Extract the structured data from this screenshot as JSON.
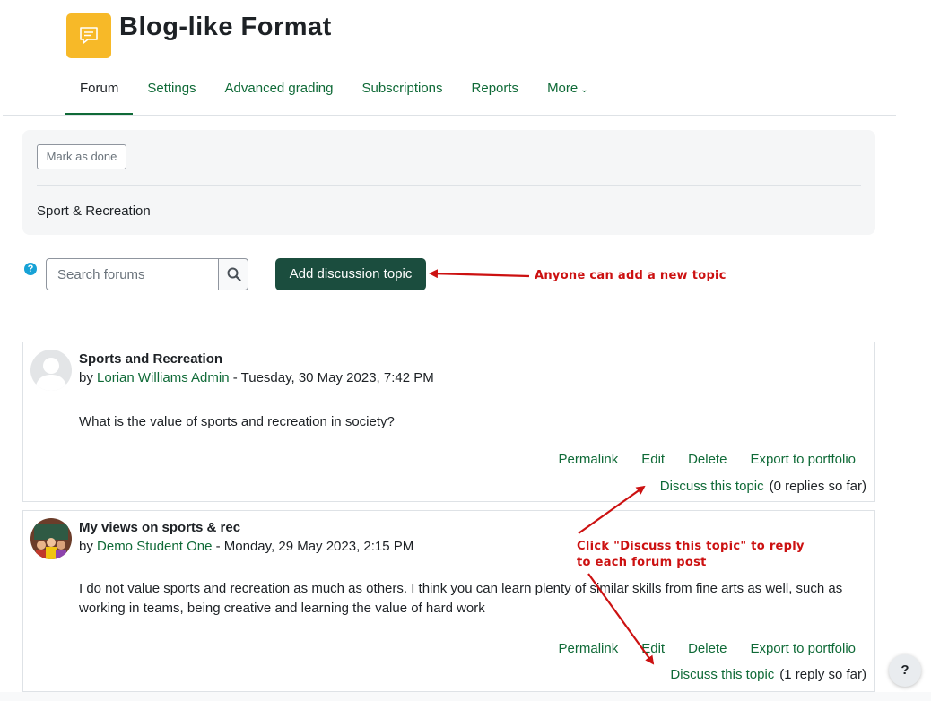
{
  "header": {
    "title": "Blog-like Format",
    "icon": "forum-chat-icon",
    "icon_color": "#f7b928"
  },
  "tabs": [
    {
      "label": "Forum",
      "active": true
    },
    {
      "label": "Settings"
    },
    {
      "label": "Advanced grading"
    },
    {
      "label": "Subscriptions"
    },
    {
      "label": "Reports"
    },
    {
      "label": "More"
    }
  ],
  "activity": {
    "mark_done_label": "Mark as done",
    "description": "Sport & Recreation"
  },
  "search": {
    "placeholder": "Search forums",
    "add_topic_label": "Add discussion topic"
  },
  "annotations": {
    "add_topic_note": "Anyone can add a new topic",
    "discuss_note_line1": "Click \"Discuss this topic\" to reply",
    "discuss_note_line2": "to each forum post",
    "color": "#cc1111"
  },
  "posts": [
    {
      "subject": "Sports and Recreation",
      "by_prefix": "by",
      "author": "Lorian Williams Admin",
      "date": "- Tuesday, 30 May 2023, 7:42 PM",
      "body": "What is the value of sports and recreation in society?",
      "actions": [
        "Permalink",
        "Edit",
        "Delete",
        "Export to portfolio"
      ],
      "discuss_label": "Discuss this topic",
      "reply_count": "(0 replies so far)"
    },
    {
      "subject": "My views on sports & rec",
      "by_prefix": "by",
      "author": "Demo Student One",
      "date": "- Monday, 29 May 2023, 2:15 PM",
      "body": "I do not value sports and recreation as much as others. I think you can learn plenty of similar skills from fine arts as well, such as working in teams, being creative and learning the value of hard work",
      "actions": [
        "Permalink",
        "Edit",
        "Delete",
        "Export to portfolio"
      ],
      "discuss_label": "Discuss this topic",
      "reply_count": "(1 reply so far)"
    }
  ],
  "help_fab_label": "?",
  "theme": {
    "link_color": "#0f6a37",
    "primary_button": "#1b4d3e"
  }
}
